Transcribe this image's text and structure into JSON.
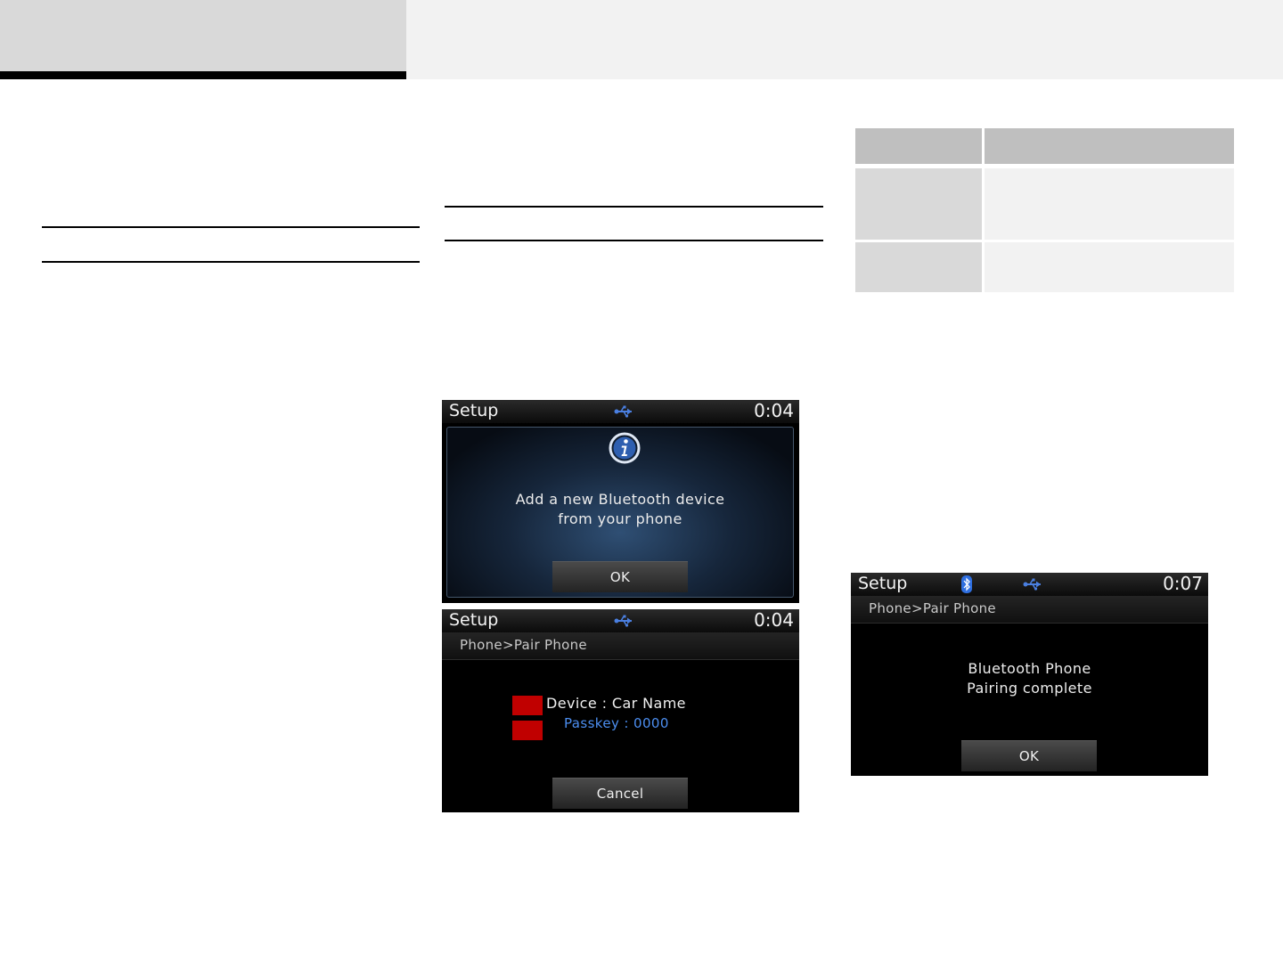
{
  "screens": {
    "add_device": {
      "title": "Setup",
      "time": "0:04",
      "message_line1": "Add a new Bluetooth device",
      "message_line2": "from your phone",
      "ok_label": "OK"
    },
    "pair_phone": {
      "title": "Setup",
      "time": "0:04",
      "breadcrumb": "Phone>Pair Phone",
      "device_label": "Device : Car Name",
      "passkey_label": "Passkey : 0000",
      "cancel_label": "Cancel"
    },
    "pairing_complete": {
      "title": "Setup",
      "time": "0:07",
      "breadcrumb": "Phone>Pair Phone",
      "message_line1": "Bluetooth Phone",
      "message_line2": "Pairing complete",
      "ok_label": "OK"
    }
  },
  "colors": {
    "header_left": "#d9d9d9",
    "header_right": "#f2f2f2",
    "table_header": "#bfbfbf",
    "table_body": "#d9d9d9",
    "redaction": "#c00000",
    "passkey_text": "#4c8ef0",
    "usb_icon": "#4a7fe0"
  },
  "icons": [
    "usb-icon",
    "bluetooth-icon",
    "info-icon"
  ]
}
